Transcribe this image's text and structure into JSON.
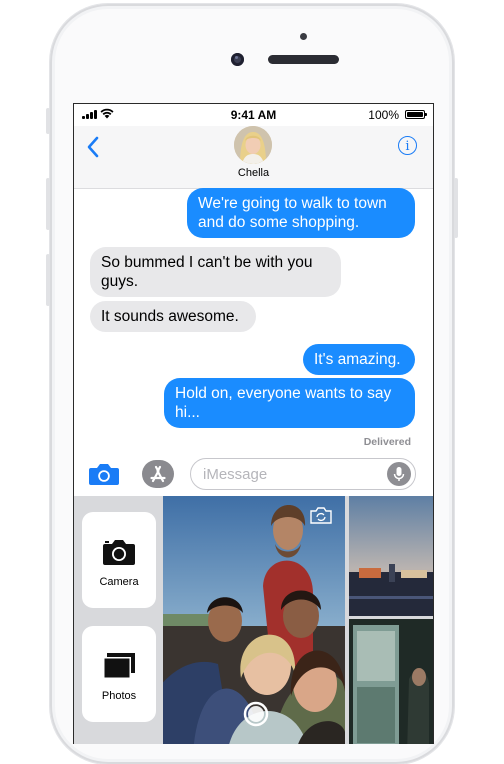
{
  "status_bar": {
    "time": "9:41 AM",
    "battery": "100%"
  },
  "contact": {
    "name": "Chella"
  },
  "messages": [
    {
      "direction": "outgoing",
      "lines": [
        "We're going to walk to town",
        "and do some shopping."
      ]
    },
    {
      "direction": "incoming",
      "lines": [
        "So bummed I can't be with you",
        "guys."
      ]
    },
    {
      "direction": "incoming",
      "lines": [
        "It sounds awesome."
      ]
    },
    {
      "direction": "outgoing",
      "lines": [
        "It's amazing."
      ]
    },
    {
      "direction": "outgoing",
      "lines": [
        "Hold on, everyone wants to say",
        "hi..."
      ]
    }
  ],
  "delivery_status": "Delivered",
  "composer": {
    "placeholder": "iMessage"
  },
  "photo_tray": {
    "camera_label": "Camera",
    "photos_label": "Photos"
  },
  "colors": {
    "accent": "#1a7cf6",
    "outgoing_bubble": "#1a8cff",
    "incoming_bubble": "#e8e8ea"
  },
  "icons": [
    "back-chevron-icon",
    "info-icon",
    "camera-icon",
    "app-store-icon",
    "microphone-icon",
    "switch-camera-icon",
    "shutter-icon",
    "photos-icon"
  ]
}
